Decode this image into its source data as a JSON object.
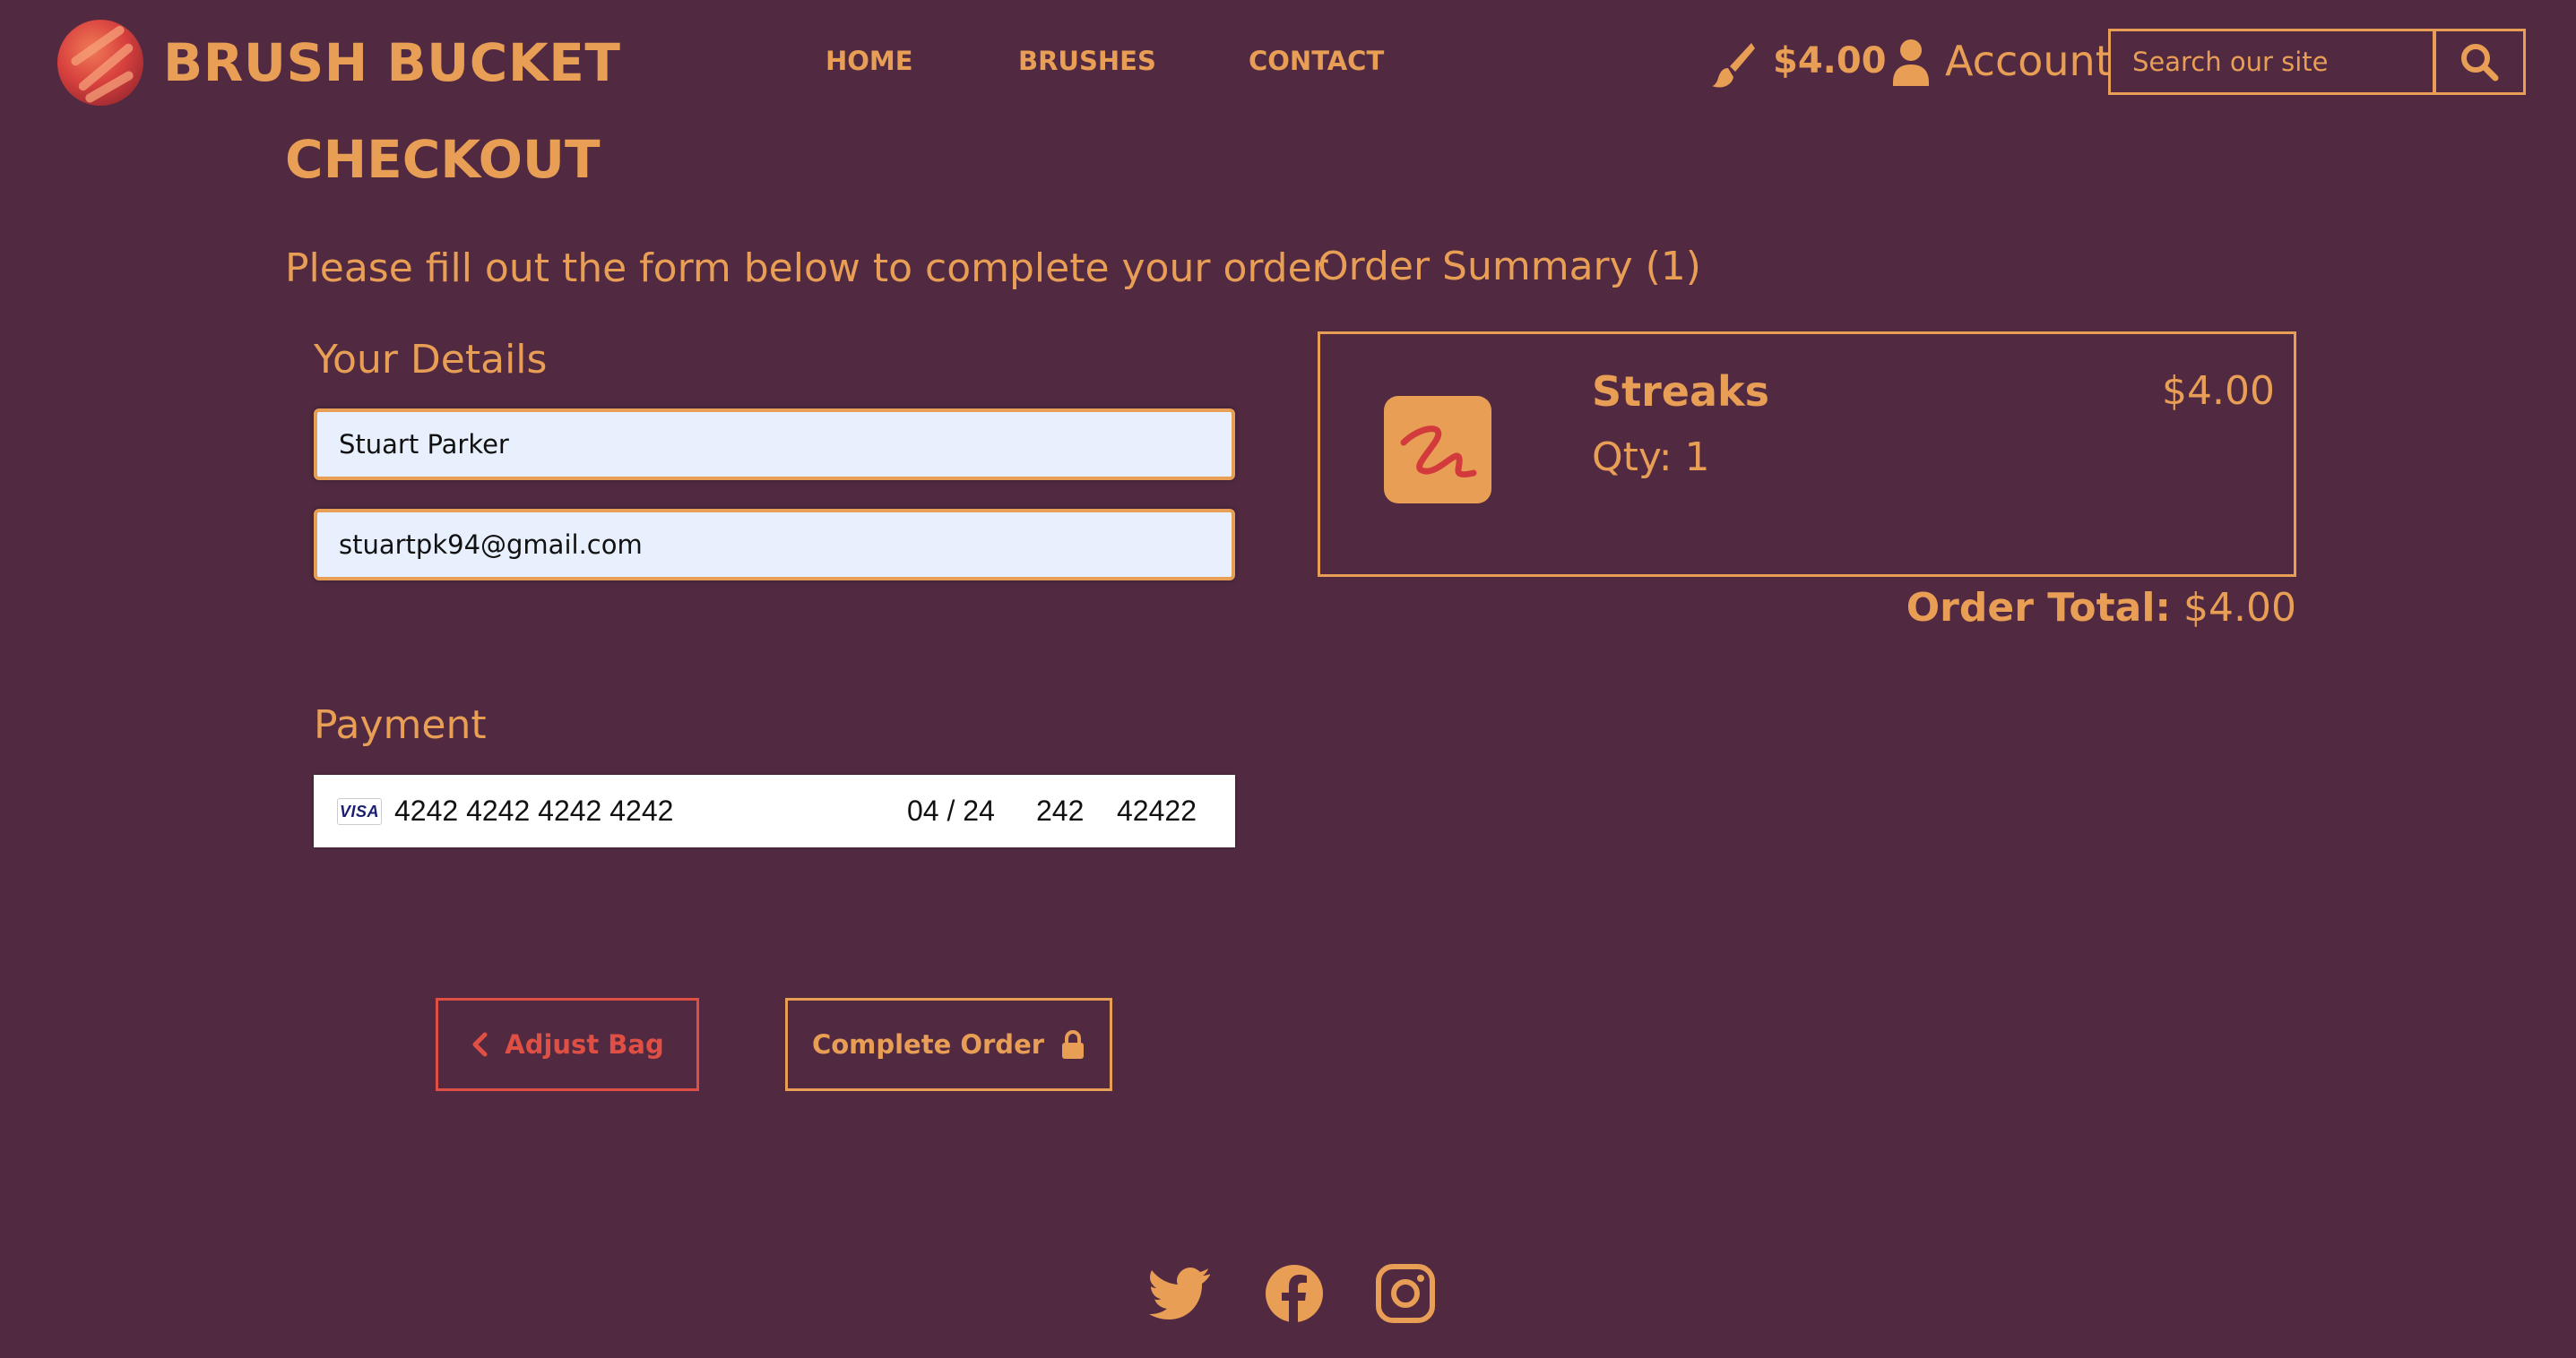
{
  "header": {
    "brand": "BRUSH BUCKET",
    "nav": [
      "HOME",
      "BRUSHES",
      "CONTACT"
    ],
    "bag_total": "$4.00",
    "account_label": "Account",
    "search_placeholder": "Search our site",
    "icons": [
      "brush-logo",
      "paintbrush-icon",
      "user-icon",
      "search-icon"
    ]
  },
  "checkout": {
    "title": "CHECKOUT",
    "intro": "Please fill out the form below to complete your order",
    "details_heading": "Your Details",
    "full_name": "Stuart Parker",
    "email": "stuartpk94@gmail.com",
    "payment_heading": "Payment",
    "card": {
      "brand": "VISA",
      "number": "4242 4242 4242 4242",
      "expiry": "04 / 24",
      "cvc": "242",
      "postal": "42422"
    }
  },
  "summary": {
    "heading": "Order Summary (1)",
    "item": {
      "name": "Streaks",
      "qty": "Qty: 1",
      "price": "$4.00"
    },
    "total_label": "Order Total:",
    "total_value": "$4.00"
  },
  "actions": {
    "adjust": "Adjust Bag",
    "complete": "Complete Order"
  },
  "footer": {
    "icons": [
      "twitter-icon",
      "facebook-icon",
      "instagram-icon"
    ]
  },
  "colors": {
    "background": "#512a41",
    "accent": "#e89e55",
    "danger": "#df4f43"
  }
}
